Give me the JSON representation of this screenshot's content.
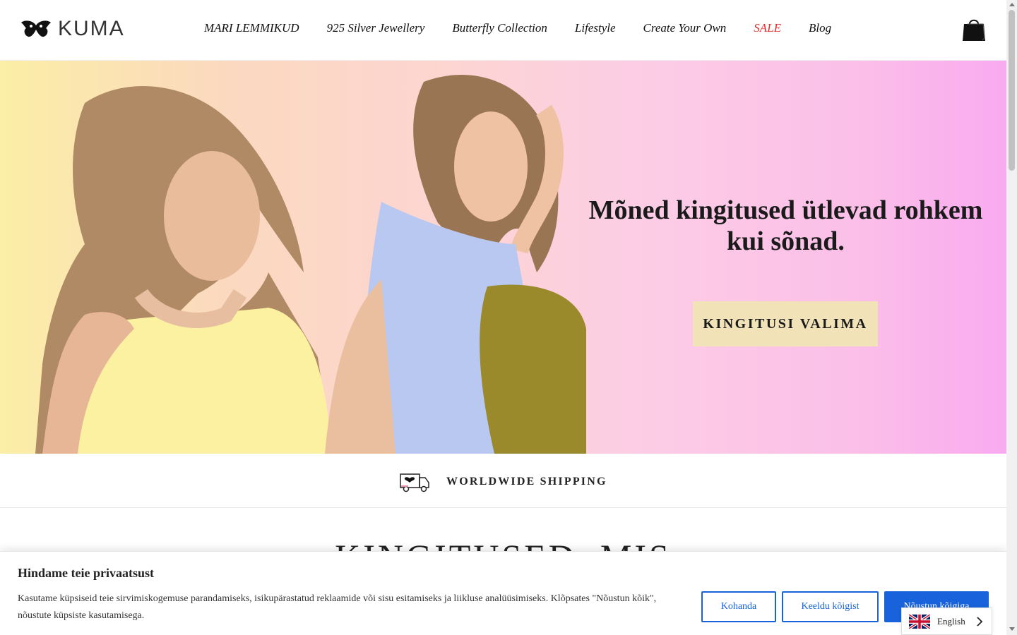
{
  "brand": {
    "name": "KUMA"
  },
  "nav": {
    "items": [
      {
        "label": "MARI LEMMIKUD"
      },
      {
        "label": "925 Silver Jewellery"
      },
      {
        "label": "Butterfly Collection"
      },
      {
        "label": "Lifestyle"
      },
      {
        "label": "Create Your Own"
      },
      {
        "label": "SALE",
        "color": "#e0312f"
      },
      {
        "label": "Blog"
      }
    ]
  },
  "icons": {
    "cart": "shopping-bag-icon",
    "shipping": "delivery-truck-icon",
    "flag": "uk-flag-icon"
  },
  "hero": {
    "title": "Mõned kingitused ütlevad rohkem kui sõnad.",
    "button_label": "KINGITUSI VALIMA"
  },
  "shipping": {
    "label": "WORLDWIDE SHIPPING"
  },
  "section": {
    "title": "KINGITUSED, MIS"
  },
  "cookie": {
    "title": "Hindame teie privaatsust",
    "text": "Kasutame küpsiseid teie sirvimiskogemuse parandamiseks, isikupärastatud reklaamide või sisu esitamiseks ja liikluse analüüsimiseks. Klõpsates \"Nõustun kõik\", nõustute küpsiste kasutamisega.",
    "customize_label": "Kohanda",
    "reject_label": "Keeldu kõigist",
    "accept_label": "Nõustun kõigiga"
  },
  "language": {
    "label": "English"
  },
  "colors": {
    "accent_blue": "#1863dc",
    "sale_red": "#e0312f",
    "hero_button": "#f1e2b8"
  }
}
